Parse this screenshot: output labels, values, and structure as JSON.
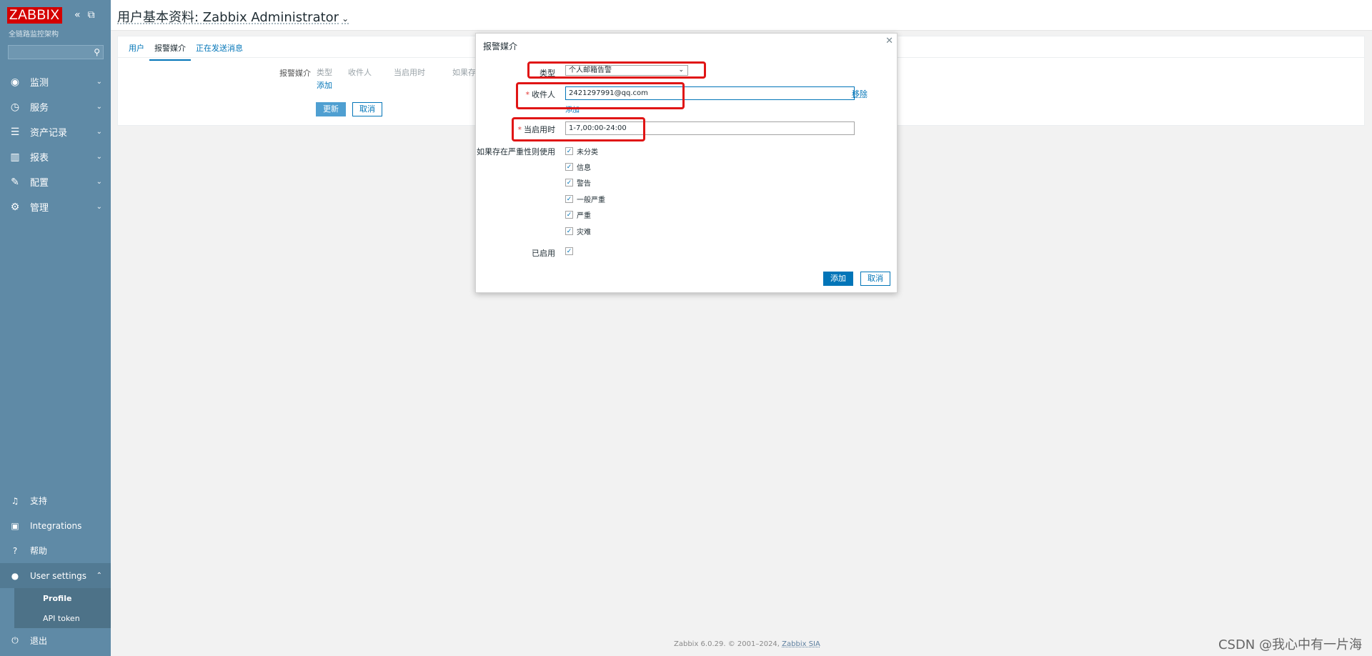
{
  "sidebar": {
    "logo": "ZABBIX",
    "subtitle": "全链路监控架构",
    "search_placeholder": "",
    "nav_items": [
      {
        "label": "监测",
        "icon": "eye-icon"
      },
      {
        "label": "服务",
        "icon": "clock-icon"
      },
      {
        "label": "资产记录",
        "icon": "list-icon"
      },
      {
        "label": "报表",
        "icon": "bar-chart-icon"
      },
      {
        "label": "配置",
        "icon": "wrench-icon"
      },
      {
        "label": "管理",
        "icon": "gear-icon"
      }
    ],
    "bottom_items": [
      {
        "label": "支持",
        "icon": "headset-icon"
      },
      {
        "label": "Integrations",
        "icon": "integrations-icon"
      },
      {
        "label": "帮助",
        "icon": "question-icon"
      },
      {
        "label": "User settings",
        "icon": "user-icon"
      }
    ],
    "user_sub_items": [
      "Profile",
      "API token"
    ],
    "logout": "退出"
  },
  "header": {
    "title": "用户基本资料: Zabbix Administrator"
  },
  "main": {
    "tabs": [
      "用户",
      "报警媒介",
      "正在发送消息"
    ],
    "active_tab": "报警媒介",
    "form_label": "报警媒介",
    "table_columns": [
      "类型",
      "收件人",
      "当启用时",
      "如果存"
    ],
    "add_link": "添加",
    "update_button": "更新",
    "cancel_button": "取消"
  },
  "dialog": {
    "title": "报警媒介",
    "type_label": "类型",
    "type_value": "个人邮箱告警",
    "recipient_label": "收件人",
    "recipient_value": "2421297991@qq.com",
    "remove_link": "移除",
    "add_link": "添加",
    "period_label": "当启用时",
    "period_value": "1-7,00:00-24:00",
    "severity_label": "如果存在严重性则使用",
    "severities": [
      "未分类",
      "信息",
      "警告",
      "一般严重",
      "严重",
      "灾难"
    ],
    "enabled_label": "已启用",
    "add_button": "添加",
    "cancel_button": "取消"
  },
  "footer": {
    "text": "Zabbix 6.0.29. © 2001–2024,",
    "link": "Zabbix SIA"
  },
  "watermark": "CSDN @我心中有一片海",
  "colors": {
    "sidebar": "#5f8aa6",
    "brand_red": "#d40000",
    "primary": "#0275b8",
    "highlight": "#e01515"
  }
}
